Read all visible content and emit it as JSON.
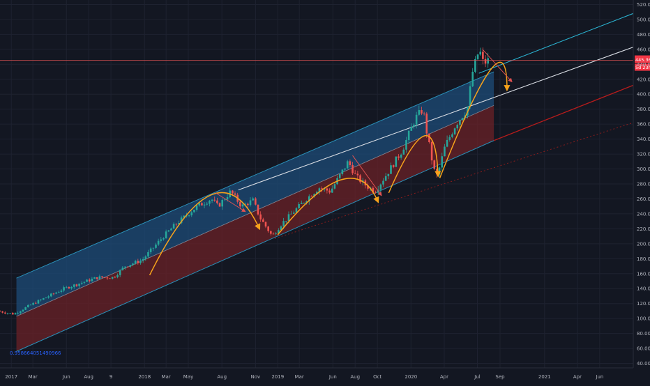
{
  "colors": {
    "background": "#131722",
    "grid": "#1e2230",
    "axis_text": "#b2b5be",
    "candle_up": "#26a69a",
    "candle_down": "#ef5350",
    "channel_upper_fill": "#1d4c78",
    "channel_lower_fill": "#6b2227",
    "channel_line": "#2a8fb7",
    "upper_trendline": "#2bb3d1",
    "mid_trendline": "#d9dde4",
    "lower_trendline": "#b71c1c",
    "dotted_trendline": "#8b1c1c",
    "arc": "#f7a21b",
    "price_line": "#e05252",
    "label_fill": "#f23645",
    "label_text": "#ffffff",
    "stat_text": "#2962ff"
  },
  "chart_data": {
    "type": "candlestick",
    "title": "",
    "xlabel": "",
    "ylabel": "",
    "ylim": [
      34,
      526
    ],
    "x_range": [
      "2016-12-01",
      "2021-09-01"
    ],
    "grid": true,
    "y_ticks": [
      40,
      60,
      80,
      100,
      120,
      140,
      160,
      180,
      200,
      220,
      240,
      260,
      280,
      300,
      320,
      340,
      360,
      380,
      400,
      420,
      440,
      460,
      480,
      500,
      520
    ],
    "y_tick_labels": [
      "40.00",
      "60.00",
      "80.00",
      "100.00",
      "120.00",
      "140.00",
      "160.00",
      "180.00",
      "200.00",
      "220.00",
      "240.00",
      "260.00",
      "280.00",
      "300.00",
      "320.00",
      "340.00",
      "360.00",
      "380.00",
      "400.00",
      "420.00",
      "440.00",
      "460.00",
      "480.00",
      "500.00",
      "520.00"
    ],
    "x_ticks": [
      {
        "date": "2017-01-01",
        "label": "2017"
      },
      {
        "date": "2017-03-01",
        "label": "Mar"
      },
      {
        "date": "2017-06-01",
        "label": "Jun"
      },
      {
        "date": "2017-08-01",
        "label": "Aug"
      },
      {
        "date": "2017-10-01",
        "label": "9"
      },
      {
        "date": "2018-01-01",
        "label": "2018"
      },
      {
        "date": "2018-03-01",
        "label": "Mar"
      },
      {
        "date": "2018-05-01",
        "label": "May"
      },
      {
        "date": "2018-08-01",
        "label": "Aug"
      },
      {
        "date": "2018-11-01",
        "label": "Nov"
      },
      {
        "date": "2019-01-01",
        "label": "2019"
      },
      {
        "date": "2019-03-01",
        "label": "Mar"
      },
      {
        "date": "2019-06-01",
        "label": "Jun"
      },
      {
        "date": "2019-08-01",
        "label": "Aug"
      },
      {
        "date": "2019-10-01",
        "label": "Oct"
      },
      {
        "date": "2020-01-01",
        "label": "2020"
      },
      {
        "date": "2020-04-01",
        "label": "Apr"
      },
      {
        "date": "2020-07-01",
        "label": "Jul"
      },
      {
        "date": "2020-09-01",
        "label": "Sep"
      },
      {
        "date": "2021-01-01",
        "label": "2021"
      },
      {
        "date": "2021-04-01",
        "label": "Apr"
      },
      {
        "date": "2021-06-01",
        "label": "Jun"
      }
    ],
    "price_anchors": [
      {
        "date": "2016-12-01",
        "value": 110
      },
      {
        "date": "2017-01-15",
        "value": 106
      },
      {
        "date": "2017-03-01",
        "value": 118
      },
      {
        "date": "2017-06-01",
        "value": 140
      },
      {
        "date": "2017-09-01",
        "value": 155
      },
      {
        "date": "2017-10-15",
        "value": 155
      },
      {
        "date": "2017-11-15",
        "value": 170
      },
      {
        "date": "2018-01-01",
        "value": 178
      },
      {
        "date": "2018-03-01",
        "value": 210
      },
      {
        "date": "2018-04-01",
        "value": 225
      },
      {
        "date": "2018-06-01",
        "value": 250
      },
      {
        "date": "2018-07-10",
        "value": 260
      },
      {
        "date": "2018-07-28",
        "value": 250
      },
      {
        "date": "2018-09-01",
        "value": 270
      },
      {
        "date": "2018-10-01",
        "value": 250
      },
      {
        "date": "2018-11-01",
        "value": 258
      },
      {
        "date": "2018-11-20",
        "value": 235
      },
      {
        "date": "2018-12-24",
        "value": 210
      },
      {
        "date": "2019-01-15",
        "value": 225
      },
      {
        "date": "2019-04-01",
        "value": 262
      },
      {
        "date": "2019-05-01",
        "value": 275
      },
      {
        "date": "2019-06-01",
        "value": 270
      },
      {
        "date": "2019-07-20",
        "value": 310
      },
      {
        "date": "2019-08-10",
        "value": 290
      },
      {
        "date": "2019-09-01",
        "value": 280
      },
      {
        "date": "2019-10-01",
        "value": 270
      },
      {
        "date": "2019-11-01",
        "value": 292
      },
      {
        "date": "2019-12-15",
        "value": 325
      },
      {
        "date": "2020-01-20",
        "value": 368
      },
      {
        "date": "2020-02-10",
        "value": 380
      },
      {
        "date": "2020-02-20",
        "value": 350
      },
      {
        "date": "2020-03-10",
        "value": 300
      },
      {
        "date": "2020-03-20",
        "value": 290
      },
      {
        "date": "2020-04-10",
        "value": 330
      },
      {
        "date": "2020-05-10",
        "value": 360
      },
      {
        "date": "2020-06-10",
        "value": 380
      },
      {
        "date": "2020-06-25",
        "value": 430
      },
      {
        "date": "2020-07-13",
        "value": 460
      },
      {
        "date": "2020-07-25",
        "value": 440
      },
      {
        "date": "2020-08-03",
        "value": 445
      }
    ],
    "channel": {
      "start": {
        "date": "2017-01-15",
        "top": 154,
        "mid": 103,
        "bottom": 56
      },
      "end": {
        "date": "2020-08-15",
        "top": 430,
        "mid": 385,
        "bottom": 338
      }
    },
    "trendlines": [
      {
        "name": "upper",
        "from": {
          "date": "2020-07-05",
          "value": 428
        },
        "to": {
          "date": "2021-09-01",
          "value": 508
        }
      },
      {
        "name": "mid",
        "from": {
          "date": "2018-09-15",
          "value": 272
        },
        "to": {
          "date": "2021-09-01",
          "value": 463
        }
      },
      {
        "name": "lower",
        "from": {
          "date": "2020-08-15",
          "value": 338
        },
        "to": {
          "date": "2021-09-01",
          "value": 412
        }
      },
      {
        "name": "dotted",
        "from": {
          "date": "2018-12-24",
          "value": 207
        },
        "to": {
          "date": "2021-09-01",
          "value": 362
        }
      }
    ],
    "arcs": [
      {
        "from": {
          "date": "2018-01-15",
          "value": 158
        },
        "peak": {
          "date": "2018-07-01",
          "value": 265
        },
        "to": {
          "date": "2018-11-10",
          "value": 222
        }
      },
      {
        "from": {
          "date": "2019-01-01",
          "value": 212
        },
        "peak": {
          "date": "2019-06-20",
          "value": 285
        },
        "to": {
          "date": "2019-10-01",
          "value": 258
        }
      },
      {
        "from": {
          "date": "2019-11-01",
          "value": 268
        },
        "peak": {
          "date": "2020-02-05",
          "value": 344
        },
        "to": {
          "date": "2020-03-15",
          "value": 293
        }
      },
      {
        "from": {
          "date": "2020-03-20",
          "value": 288
        },
        "peak": {
          "date": "2020-08-05",
          "value": 432
        },
        "to": {
          "date": "2020-09-20",
          "value": 408
        }
      }
    ],
    "annotation_lines": [
      {
        "from": {
          "date": "2018-07-15",
          "value": 268
        },
        "to": {
          "date": "2018-10-01",
          "value": 244
        }
      },
      {
        "from": {
          "date": "2019-07-25",
          "value": 318
        },
        "to": {
          "date": "2019-10-10",
          "value": 266
        }
      },
      {
        "from": {
          "date": "2020-07-15",
          "value": 460
        },
        "to": {
          "date": "2020-10-01",
          "value": 418
        }
      }
    ],
    "current_price": 445.36,
    "price_label": "445.36",
    "countdown_label": "5d 23h",
    "stat_text": "0.958664051490966"
  }
}
